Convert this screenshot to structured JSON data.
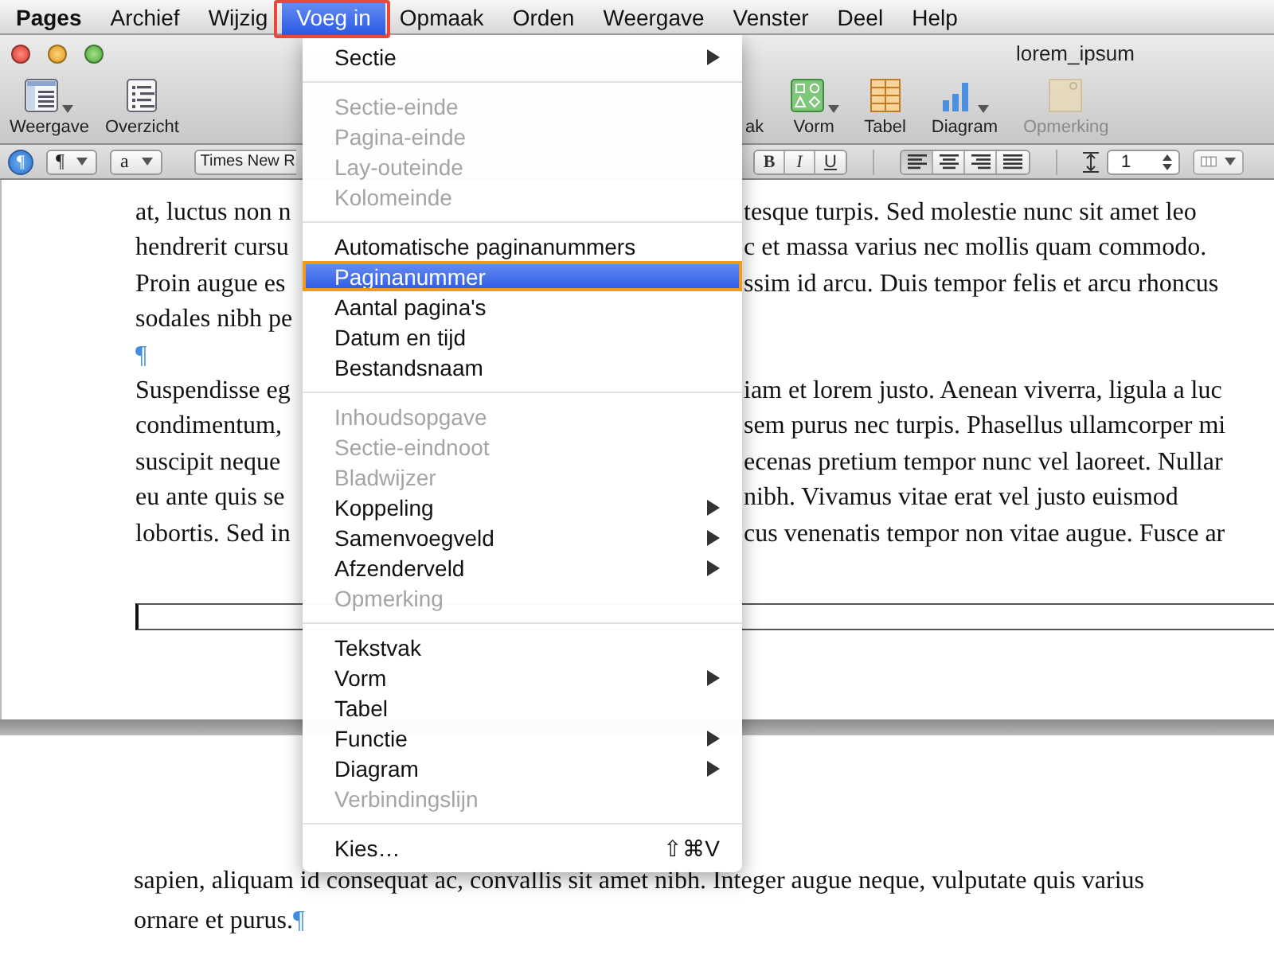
{
  "menubar": {
    "items": [
      {
        "label": "Pages",
        "kind": "app",
        "selected": false,
        "highlighted": false
      },
      {
        "label": "Archief",
        "kind": "menu",
        "selected": false,
        "highlighted": false
      },
      {
        "label": "Wijzig",
        "kind": "menu",
        "selected": false,
        "highlighted": false
      },
      {
        "label": "Voeg in",
        "kind": "menu",
        "selected": true,
        "highlighted": true
      },
      {
        "label": "Opmaak",
        "kind": "menu",
        "selected": false,
        "highlighted": false
      },
      {
        "label": "Orden",
        "kind": "menu",
        "selected": false,
        "highlighted": false
      },
      {
        "label": "Weergave",
        "kind": "menu",
        "selected": false,
        "highlighted": false
      },
      {
        "label": "Venster",
        "kind": "menu",
        "selected": false,
        "highlighted": false
      },
      {
        "label": "Deel",
        "kind": "menu",
        "selected": false,
        "highlighted": false
      },
      {
        "label": "Help",
        "kind": "menu",
        "selected": false,
        "highlighted": false
      }
    ]
  },
  "window": {
    "title": "lorem_ipsum"
  },
  "toolbar": {
    "left": [
      {
        "label": "Weergave",
        "kind": "view",
        "dropdown": true,
        "disabled": false
      },
      {
        "label": "Overzicht",
        "kind": "outline",
        "dropdown": false,
        "disabled": false
      }
    ],
    "right": [
      {
        "label": "ak",
        "kind": "partial"
      },
      {
        "label": "Vorm",
        "kind": "shape",
        "dropdown": true,
        "disabled": false
      },
      {
        "label": "Tabel",
        "kind": "table",
        "dropdown": false,
        "disabled": false
      },
      {
        "label": "Diagram",
        "kind": "chart",
        "dropdown": true,
        "disabled": false
      },
      {
        "label": "Opmerking",
        "kind": "comment",
        "dropdown": false,
        "disabled": true
      }
    ]
  },
  "format_bar": {
    "invisibles": {
      "on": true
    },
    "popups": [
      {
        "label": "¶",
        "dropdown": true
      },
      {
        "label": "a",
        "dropdown": true
      },
      {
        "label": "Times New R",
        "dropdown": false
      }
    ],
    "style_buttons": [
      {
        "label": "B",
        "kind": "bold"
      },
      {
        "label": "I",
        "kind": "italic"
      },
      {
        "label": "U",
        "kind": "underline"
      }
    ],
    "alignment": [
      {
        "kind": "left",
        "selected": true
      },
      {
        "kind": "center",
        "selected": false
      },
      {
        "kind": "right",
        "selected": false
      },
      {
        "kind": "justify",
        "selected": false
      }
    ],
    "line_spacing": "1"
  },
  "document": {
    "page1": [
      {
        "left": "at, luctus non n",
        "right": "tesque turpis. Sed molestie nunc sit amet leo"
      },
      {
        "left": "hendrerit cursu",
        "right": "c et massa varius nec mollis quam commodo."
      },
      {
        "left": "Proin augue es",
        "right": "ssim id arcu. Duis tempor felis et arcu rhoncus"
      },
      {
        "left": "sodales nibh pe"
      },
      {
        "mark": "¶"
      },
      {
        "left": "Suspendisse eg",
        "right": "iam et lorem justo. Aenean viverra, ligula a luc"
      },
      {
        "left": "condimentum,",
        "right": "sem purus nec turpis. Phasellus ullamcorper mi"
      },
      {
        "left": "suscipit neque",
        "right": "ecenas pretium tempor nunc vel laoreet. Nullar"
      },
      {
        "left": "eu ante quis se",
        "right": "nibh. Vivamus vitae erat vel justo euismod"
      },
      {
        "left": "lobortis. Sed in",
        "right": "cus venenatis tempor non vitae augue. Fusce ar"
      }
    ],
    "page2": [
      {
        "text": "sapien, aliquam id consequat ac, convallis sit amet nibh. Integer augue neque, vulputate quis varius"
      },
      {
        "text": "ornare et purus.",
        "mark": "¶"
      }
    ]
  },
  "menu": {
    "items": [
      {
        "kind": "item",
        "label": "Sectie",
        "submenu": true,
        "disabled": false,
        "selected": false
      },
      {
        "kind": "separator"
      },
      {
        "kind": "item",
        "label": "Sectie-einde",
        "submenu": false,
        "disabled": true,
        "selected": false
      },
      {
        "kind": "item",
        "label": "Pagina-einde",
        "submenu": false,
        "disabled": true,
        "selected": false
      },
      {
        "kind": "item",
        "label": "Lay-outeinde",
        "submenu": false,
        "disabled": true,
        "selected": false
      },
      {
        "kind": "item",
        "label": "Kolomeinde",
        "submenu": false,
        "disabled": true,
        "selected": false
      },
      {
        "kind": "separator"
      },
      {
        "kind": "item",
        "label": "Automatische paginanummers",
        "submenu": false,
        "disabled": false,
        "selected": false
      },
      {
        "kind": "item",
        "label": "Paginanummer",
        "submenu": false,
        "disabled": false,
        "selected": true,
        "highlighted": true
      },
      {
        "kind": "item",
        "label": "Aantal pagina's",
        "submenu": false,
        "disabled": false,
        "selected": false
      },
      {
        "kind": "item",
        "label": "Datum en tijd",
        "submenu": false,
        "disabled": false,
        "selected": false
      },
      {
        "kind": "item",
        "label": "Bestandsnaam",
        "submenu": false,
        "disabled": false,
        "selected": false
      },
      {
        "kind": "separator"
      },
      {
        "kind": "item",
        "label": "Inhoudsopgave",
        "submenu": false,
        "disabled": true,
        "selected": false
      },
      {
        "kind": "item",
        "label": "Sectie-eindnoot",
        "submenu": false,
        "disabled": true,
        "selected": false
      },
      {
        "kind": "item",
        "label": "Bladwijzer",
        "submenu": false,
        "disabled": true,
        "selected": false
      },
      {
        "kind": "item",
        "label": "Koppeling",
        "submenu": true,
        "disabled": false,
        "selected": false
      },
      {
        "kind": "item",
        "label": "Samenvoegveld",
        "submenu": true,
        "disabled": false,
        "selected": false
      },
      {
        "kind": "item",
        "label": "Afzenderveld",
        "submenu": true,
        "disabled": false,
        "selected": false
      },
      {
        "kind": "item",
        "label": "Opmerking",
        "submenu": false,
        "disabled": true,
        "selected": false
      },
      {
        "kind": "separator"
      },
      {
        "kind": "item",
        "label": "Tekstvak",
        "submenu": false,
        "disabled": false,
        "selected": false
      },
      {
        "kind": "item",
        "label": "Vorm",
        "submenu": true,
        "disabled": false,
        "selected": false
      },
      {
        "kind": "item",
        "label": "Tabel",
        "submenu": false,
        "disabled": false,
        "selected": false
      },
      {
        "kind": "item",
        "label": "Functie",
        "submenu": true,
        "disabled": false,
        "selected": false
      },
      {
        "kind": "item",
        "label": "Diagram",
        "submenu": true,
        "disabled": false,
        "selected": false
      },
      {
        "kind": "item",
        "label": "Verbindingslijn",
        "submenu": false,
        "disabled": true,
        "selected": false
      },
      {
        "kind": "separator"
      },
      {
        "kind": "item",
        "label": "Kies…",
        "submenu": false,
        "disabled": false,
        "selected": false,
        "shortcut": "⇧⌘V"
      }
    ]
  }
}
